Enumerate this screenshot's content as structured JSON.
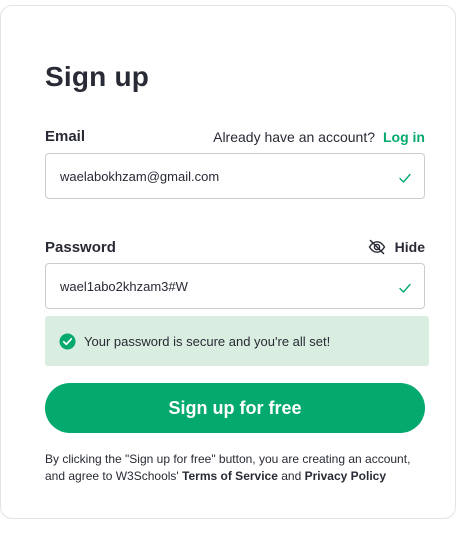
{
  "form": {
    "title": "Sign up",
    "email": {
      "label": "Email",
      "value": "waelabokhzam@gmail.com",
      "login_prompt": "Already have an account?",
      "login_link": "Log in"
    },
    "password": {
      "label": "Password",
      "value": "wael1abo2khzam3#W",
      "toggle_label": "Hide"
    },
    "success_message": "Your password is secure and you're all set!",
    "submit_label": "Sign up for free",
    "terms": {
      "prefix": "By clicking the \"Sign up for free\" button, you are creating an account, and agree to W3Schools'",
      "terms_link": "Terms of Service",
      "conjunction": "and",
      "privacy_link": "Privacy Policy"
    }
  },
  "colors": {
    "accent": "#04aa6d",
    "success_bg": "#d9eee1",
    "text": "#282a35",
    "border": "#cccccc"
  },
  "icons": {
    "hide": "eye-slash-icon",
    "valid": "checkmark-icon",
    "success": "circle-check-icon"
  }
}
